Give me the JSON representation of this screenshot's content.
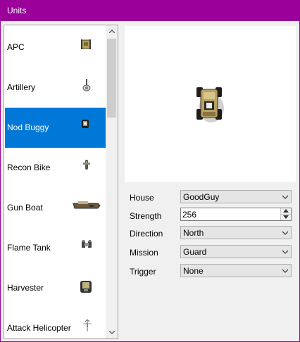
{
  "window": {
    "title": "Units"
  },
  "units": [
    {
      "label": "APC",
      "icon": "apc-icon"
    },
    {
      "label": "Artillery",
      "icon": "artillery-icon"
    },
    {
      "label": "Nod Buggy",
      "icon": "nod-buggy-icon",
      "selected": true
    },
    {
      "label": "Recon Bike",
      "icon": "recon-bike-icon"
    },
    {
      "label": "Gun Boat",
      "icon": "gun-boat-icon"
    },
    {
      "label": "Flame Tank",
      "icon": "flame-tank-icon"
    },
    {
      "label": "Harvester",
      "icon": "harvester-icon"
    },
    {
      "label": "Attack Helicopter",
      "icon": "attack-helicopter-icon"
    }
  ],
  "properties": {
    "house": {
      "label": "House",
      "value": "GoodGuy"
    },
    "strength": {
      "label": "Strength",
      "value": "256"
    },
    "direction": {
      "label": "Direction",
      "value": "North"
    },
    "mission": {
      "label": "Mission",
      "value": "Guard"
    },
    "trigger": {
      "label": "Trigger",
      "value": "None"
    }
  },
  "colors": {
    "title_bar": "#9b009b",
    "selection": "#0078d7"
  }
}
